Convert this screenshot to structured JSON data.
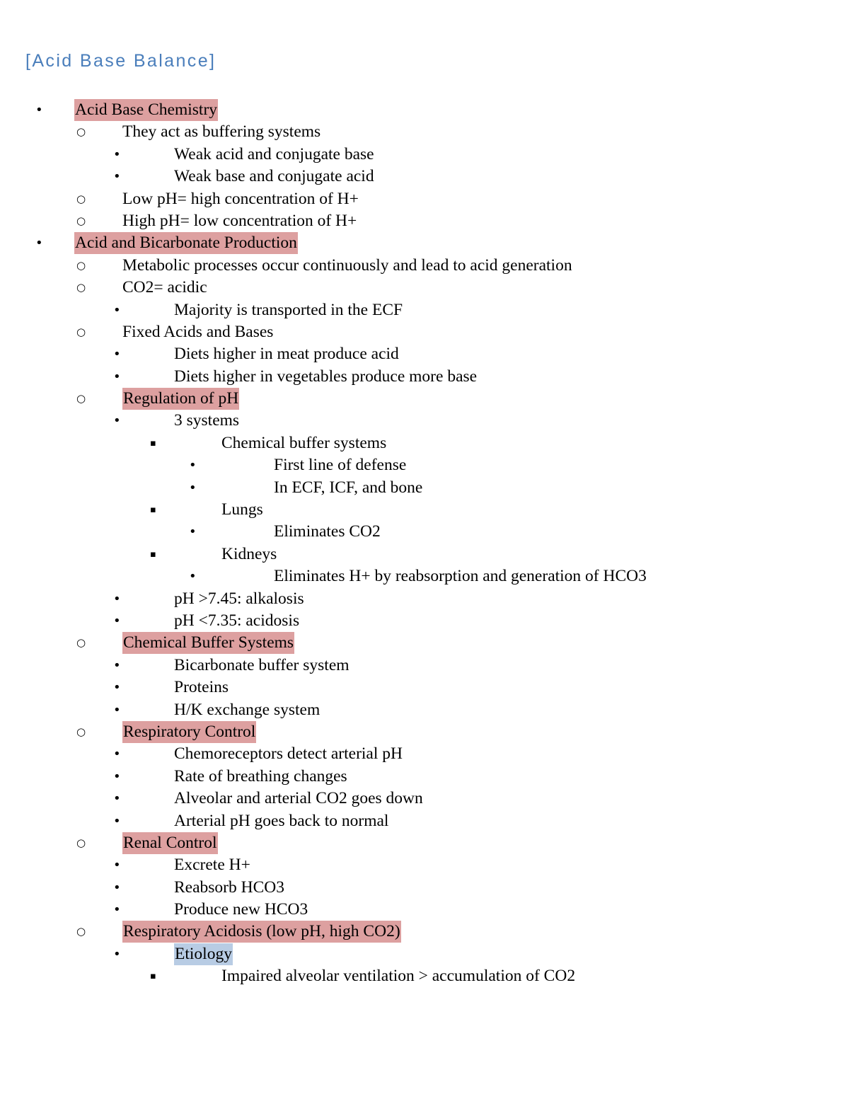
{
  "document": {
    "title": "[Acid Base Balance]",
    "title_color": "#4a7ebb",
    "background_color": "#ffffff",
    "text_color": "#000000"
  },
  "highlights": {
    "pink": "#dda0a0",
    "blue": "#b8cce4"
  },
  "bullet_glyphs": {
    "disc": "•",
    "circle": "○",
    "square": "▪"
  },
  "outline": [
    {
      "level": 1,
      "bullet": "disc",
      "text": "Acid Base Chemistry",
      "highlight": "pink"
    },
    {
      "level": 2,
      "bullet": "circle",
      "text": "They act as buffering systems",
      "highlight": "none"
    },
    {
      "level": 3,
      "bullet": "disc",
      "text": "Weak acid and conjugate base",
      "highlight": "none"
    },
    {
      "level": 3,
      "bullet": "disc",
      "text": "Weak base and conjugate acid",
      "highlight": "none"
    },
    {
      "level": 2,
      "bullet": "circle",
      "text": "Low pH= high concentration of H+",
      "highlight": "none"
    },
    {
      "level": 2,
      "bullet": "circle",
      "text": "High pH= low concentration of H+",
      "highlight": "none"
    },
    {
      "level": 1,
      "bullet": "disc",
      "text": "Acid and Bicarbonate Production",
      "highlight": "pink"
    },
    {
      "level": 2,
      "bullet": "circle",
      "text": "Metabolic processes occur continuously and lead to acid generation",
      "highlight": "none"
    },
    {
      "level": 2,
      "bullet": "circle",
      "text": "CO2= acidic",
      "highlight": "none"
    },
    {
      "level": 3,
      "bullet": "disc",
      "text": "Majority is transported in the ECF",
      "highlight": "none"
    },
    {
      "level": 2,
      "bullet": "circle",
      "text": "Fixed Acids and Bases",
      "highlight": "none"
    },
    {
      "level": 3,
      "bullet": "disc",
      "text": "Diets higher in meat produce acid",
      "highlight": "none"
    },
    {
      "level": 3,
      "bullet": "disc",
      "text": "Diets higher in vegetables produce more base",
      "highlight": "none"
    },
    {
      "level": 2,
      "bullet": "circle",
      "text": "Regulation of pH",
      "highlight": "pink"
    },
    {
      "level": 3,
      "bullet": "disc",
      "text": "3 systems",
      "highlight": "none"
    },
    {
      "level": 4,
      "bullet": "square",
      "text": "Chemical buffer systems",
      "highlight": "none"
    },
    {
      "level": 5,
      "bullet": "disc",
      "text": "First line of defense",
      "highlight": "none"
    },
    {
      "level": 5,
      "bullet": "disc",
      "text": "In ECF, ICF, and bone",
      "highlight": "none"
    },
    {
      "level": 4,
      "bullet": "square",
      "text": "Lungs",
      "highlight": "none"
    },
    {
      "level": 5,
      "bullet": "disc",
      "text": "Eliminates CO2",
      "highlight": "none"
    },
    {
      "level": 4,
      "bullet": "square",
      "text": "Kidneys",
      "highlight": "none"
    },
    {
      "level": 5,
      "bullet": "disc",
      "text": "Eliminates H+ by reabsorption and generation of HCO3",
      "highlight": "none"
    },
    {
      "level": 3,
      "bullet": "disc",
      "text": "pH >7.45: alkalosis",
      "highlight": "none"
    },
    {
      "level": 3,
      "bullet": "disc",
      "text": "pH <7.35: acidosis",
      "highlight": "none"
    },
    {
      "level": 2,
      "bullet": "circle",
      "text": "Chemical Buffer Systems",
      "highlight": "pink"
    },
    {
      "level": 3,
      "bullet": "disc",
      "text": "Bicarbonate buffer system",
      "highlight": "none"
    },
    {
      "level": 3,
      "bullet": "disc",
      "text": "Proteins",
      "highlight": "none"
    },
    {
      "level": 3,
      "bullet": "disc",
      "text": "H/K exchange system",
      "highlight": "none"
    },
    {
      "level": 2,
      "bullet": "circle",
      "text": "Respiratory Control",
      "highlight": "pink"
    },
    {
      "level": 3,
      "bullet": "disc",
      "text": "Chemoreceptors detect arterial pH",
      "highlight": "none"
    },
    {
      "level": 3,
      "bullet": "disc",
      "text": "Rate of breathing changes",
      "highlight": "none"
    },
    {
      "level": 3,
      "bullet": "disc",
      "text": "Alveolar and arterial CO2 goes down",
      "highlight": "none"
    },
    {
      "level": 3,
      "bullet": "disc",
      "text": "Arterial pH goes back to normal",
      "highlight": "none"
    },
    {
      "level": 2,
      "bullet": "circle",
      "text": "Renal Control",
      "highlight": "pink"
    },
    {
      "level": 3,
      "bullet": "disc",
      "text": "Excrete H+",
      "highlight": "none"
    },
    {
      "level": 3,
      "bullet": "disc",
      "text": "Reabsorb HCO3",
      "highlight": "none"
    },
    {
      "level": 3,
      "bullet": "disc",
      "text": "Produce new HCO3",
      "highlight": "none"
    },
    {
      "level": 2,
      "bullet": "circle",
      "text": "Respiratory Acidosis (low pH, high CO2)",
      "highlight": "pink"
    },
    {
      "level": 3,
      "bullet": "disc",
      "text": "Etiology",
      "highlight": "blue"
    },
    {
      "level": 4,
      "bullet": "square",
      "text": "Impaired alveolar ventilation > accumulation of CO2",
      "highlight": "none"
    }
  ]
}
